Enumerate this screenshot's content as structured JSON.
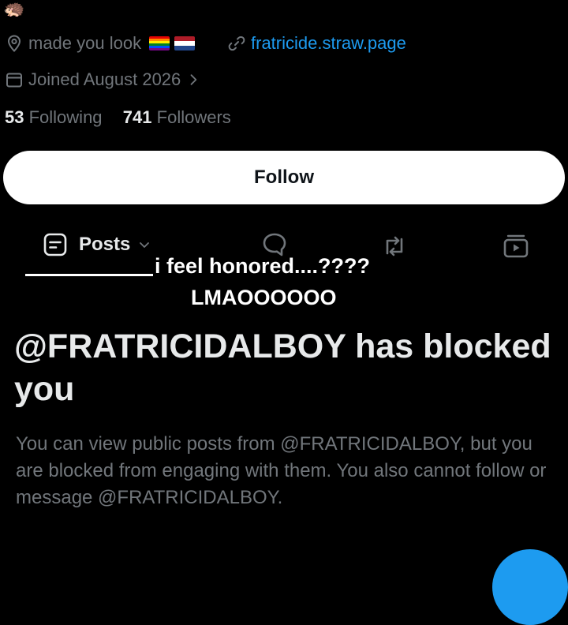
{
  "avatar": {
    "emoji": "🦔"
  },
  "profile": {
    "location": "made you look",
    "link": "fratricide.straw.page",
    "joined": "Joined August 2026",
    "following_count": "53",
    "following_label": "Following",
    "followers_count": "741",
    "followers_label": "Followers"
  },
  "follow_button": {
    "label": "Follow"
  },
  "tabs": {
    "posts_label": "Posts"
  },
  "caption": {
    "line1": "i feel honored....????",
    "line2": "LMAOOOOOO"
  },
  "blocked": {
    "heading": "@FRATRICIDALBOY has blocked you",
    "body": "You can view public posts from @FRATRICIDALBOY, but you are blocked from engaging with them. You also cannot follow or message @FRATRICIDALBOY."
  },
  "colors": {
    "background": "#000000",
    "link": "#1d9bf0",
    "muted": "#71767b",
    "text": "#e7e9ea",
    "fab": "#1d9bf0"
  },
  "icons": {
    "location": "location-pin-icon",
    "link": "link-icon",
    "calendar": "calendar-icon",
    "posts": "posts-icon",
    "replies": "reply-bubble-icon",
    "reposts": "repost-icon",
    "videos": "video-icon"
  }
}
